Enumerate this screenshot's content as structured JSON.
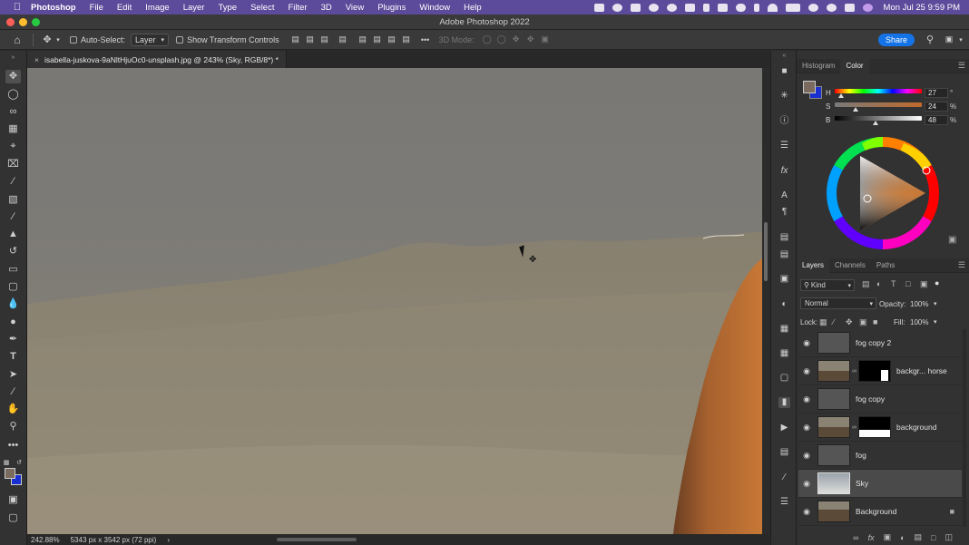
{
  "menubar": {
    "app_name": "Photoshop",
    "items": [
      "File",
      "Edit",
      "Image",
      "Layer",
      "Type",
      "Select",
      "Filter",
      "3D",
      "View",
      "Plugins",
      "Window",
      "Help"
    ],
    "clock": "Mon Jul 25  9:59 PM"
  },
  "window": {
    "title": "Adobe Photoshop 2022"
  },
  "options_bar": {
    "auto_select_label": "Auto-Select:",
    "auto_select_target": "Layer",
    "transform_controls_label": "Show Transform Controls",
    "mode_3d_label": "3D Mode:",
    "share_label": "Share"
  },
  "document": {
    "tab_title": "isabella-juskova-9aNltHjuOc0-unsplash.jpg @ 243% (Sky, RGB/8*) *",
    "zoom": "242.88%",
    "doc_info": "5343 px x 3542 px (72 ppi)"
  },
  "color_panel": {
    "tabs": [
      "Histogram",
      "Color"
    ],
    "active_tab": "Color",
    "h_label": "H",
    "h_value": "27",
    "h_unit": "°",
    "s_label": "S",
    "s_value": "24",
    "s_unit": "%",
    "b_label": "B",
    "b_value": "48",
    "b_unit": "%",
    "foreground_color": "#7a6b5e",
    "background_color": "#1a2fd0"
  },
  "layers_panel": {
    "tabs": [
      "Layers",
      "Channels",
      "Paths"
    ],
    "active_tab": "Layers",
    "filter_label": "Kind",
    "blend_mode": "Normal",
    "opacity_label": "Opacity:",
    "opacity_value": "100%",
    "lock_label": "Lock:",
    "fill_label": "Fill:",
    "fill_value": "100%",
    "layers": [
      {
        "name": "fog copy 2"
      },
      {
        "name": "backgr... horse"
      },
      {
        "name": "fog copy"
      },
      {
        "name": "background"
      },
      {
        "name": "fog"
      },
      {
        "name": "Sky"
      },
      {
        "name": "Background"
      }
    ],
    "selected_layer": "Sky"
  }
}
